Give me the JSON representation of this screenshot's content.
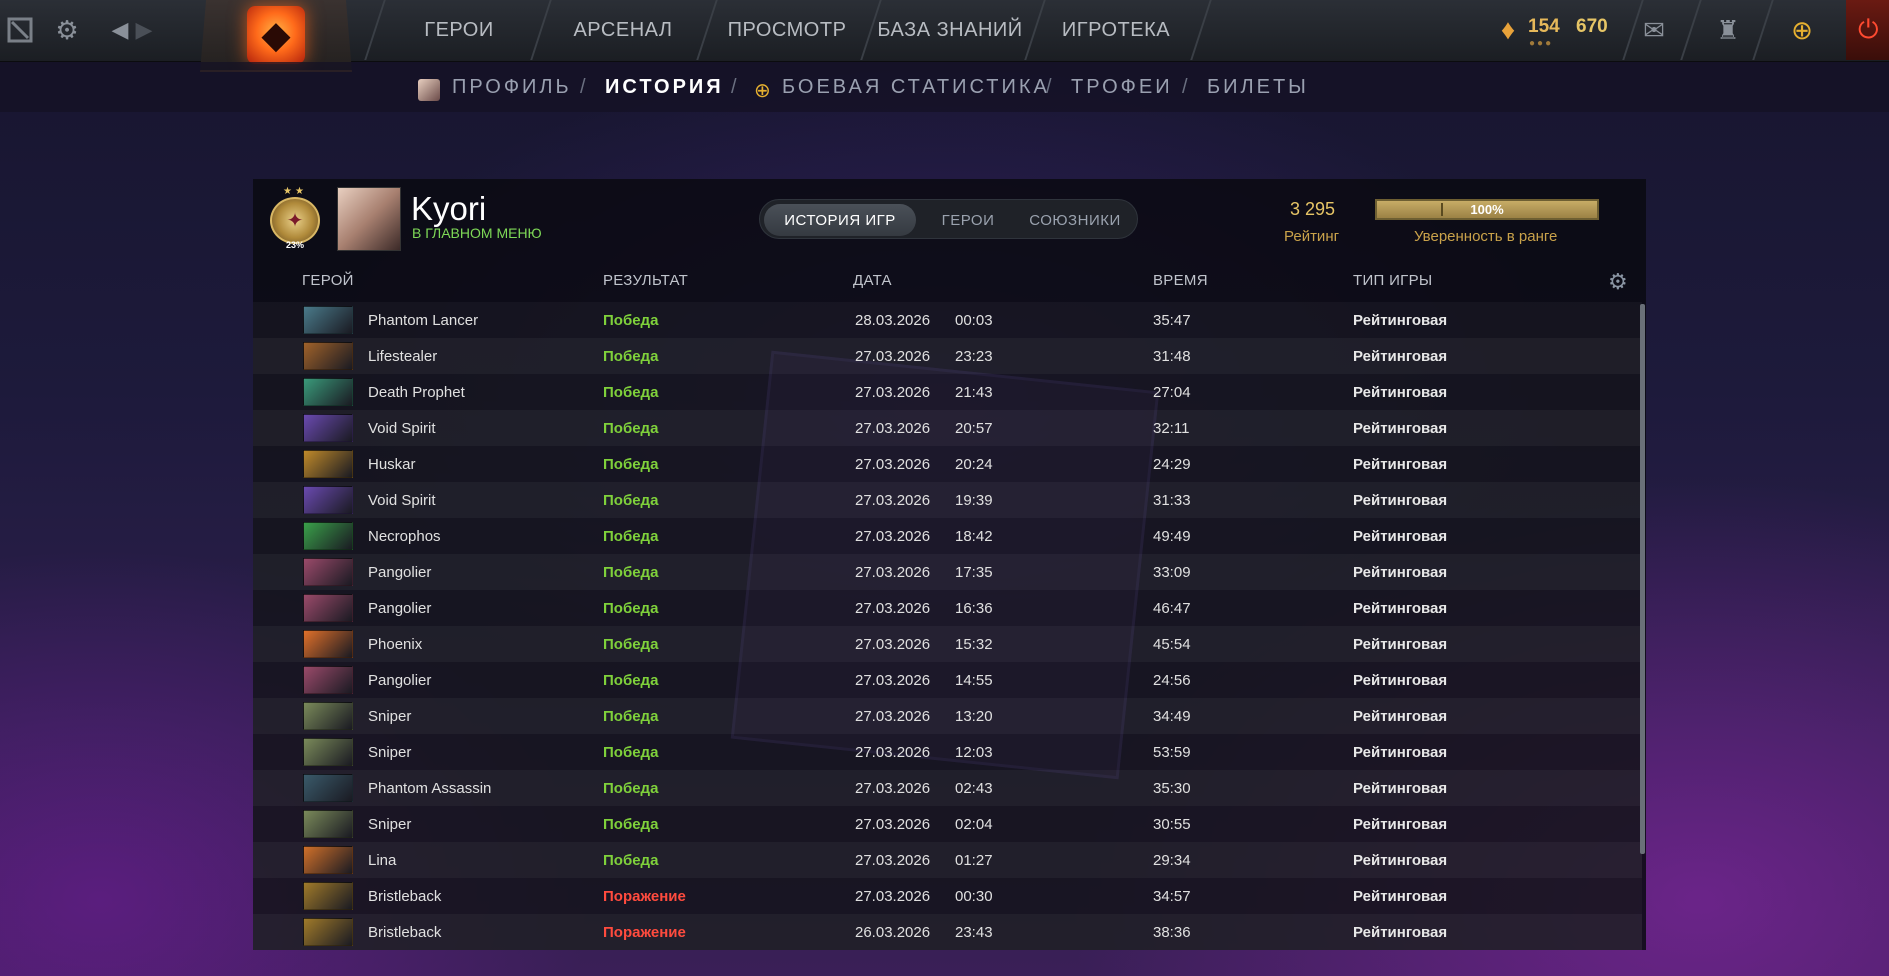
{
  "topbar": {
    "nav": [
      "ГЕРОИ",
      "АРСЕНАЛ",
      "ПРОСМОТР",
      "БАЗА ЗНАНИЙ",
      "ИГРОТЕКА"
    ],
    "shards": "154",
    "gold": "670",
    "shard_color": "#e8a23a"
  },
  "subnav": {
    "items": [
      "ПРОФИЛЬ",
      "ИСТОРИЯ",
      "БОЕВАЯ СТАТИСТИКА",
      "ТРОФЕИ",
      "БИЛЕТЫ"
    ],
    "active_index": 1,
    "separator": "/"
  },
  "player": {
    "name": "Kyori",
    "status": "В ГЛАВНОМ МЕНЮ",
    "rank_percent": "23%",
    "rating_value": "3 295",
    "rating_label": "Рейтинг",
    "confidence_text": "100%",
    "confidence_value": 1.0,
    "confidence_label": "Уверенность в ранге"
  },
  "tabs": [
    "ИСТОРИЯ ИГР",
    "ГЕРОИ",
    "СОЮЗНИКИ"
  ],
  "table": {
    "headers": [
      "ГЕРОЙ",
      "РЕЗУЛЬТАТ",
      "ДАТА",
      "ВРЕМЯ",
      "ТИП ИГРЫ"
    ],
    "rows": [
      {
        "hero": "Phantom Lancer",
        "result": "Победа",
        "win": true,
        "date": "28.03.2026",
        "time": "00:03",
        "duration": "35:47",
        "mode": "Рейтинговая",
        "color": "#4a7a8a"
      },
      {
        "hero": "Lifestealer",
        "result": "Победа",
        "win": true,
        "date": "27.03.2026",
        "time": "23:23",
        "duration": "31:48",
        "mode": "Рейтинговая",
        "color": "#a0622a"
      },
      {
        "hero": "Death Prophet",
        "result": "Победа",
        "win": true,
        "date": "27.03.2026",
        "time": "21:43",
        "duration": "27:04",
        "mode": "Рейтинговая",
        "color": "#3a9a7a"
      },
      {
        "hero": "Void Spirit",
        "result": "Победа",
        "win": true,
        "date": "27.03.2026",
        "time": "20:57",
        "duration": "32:11",
        "mode": "Рейтинговая",
        "color": "#6a4ab0"
      },
      {
        "hero": "Huskar",
        "result": "Победа",
        "win": true,
        "date": "27.03.2026",
        "time": "20:24",
        "duration": "24:29",
        "mode": "Рейтинговая",
        "color": "#c08a2a"
      },
      {
        "hero": "Void Spirit",
        "result": "Победа",
        "win": true,
        "date": "27.03.2026",
        "time": "19:39",
        "duration": "31:33",
        "mode": "Рейтинговая",
        "color": "#6a4ab0"
      },
      {
        "hero": "Necrophos",
        "result": "Победа",
        "win": true,
        "date": "27.03.2026",
        "time": "18:42",
        "duration": "49:49",
        "mode": "Рейтинговая",
        "color": "#3aa04a"
      },
      {
        "hero": "Pangolier",
        "result": "Победа",
        "win": true,
        "date": "27.03.2026",
        "time": "17:35",
        "duration": "33:09",
        "mode": "Рейтинговая",
        "color": "#9a4a6a"
      },
      {
        "hero": "Pangolier",
        "result": "Победа",
        "win": true,
        "date": "27.03.2026",
        "time": "16:36",
        "duration": "46:47",
        "mode": "Рейтинговая",
        "color": "#9a4a6a"
      },
      {
        "hero": "Phoenix",
        "result": "Победа",
        "win": true,
        "date": "27.03.2026",
        "time": "15:32",
        "duration": "45:54",
        "mode": "Рейтинговая",
        "color": "#e0702a"
      },
      {
        "hero": "Pangolier",
        "result": "Победа",
        "win": true,
        "date": "27.03.2026",
        "time": "14:55",
        "duration": "24:56",
        "mode": "Рейтинговая",
        "color": "#9a4a6a"
      },
      {
        "hero": "Sniper",
        "result": "Победа",
        "win": true,
        "date": "27.03.2026",
        "time": "13:20",
        "duration": "34:49",
        "mode": "Рейтинговая",
        "color": "#7a8a5a"
      },
      {
        "hero": "Sniper",
        "result": "Победа",
        "win": true,
        "date": "27.03.2026",
        "time": "12:03",
        "duration": "53:59",
        "mode": "Рейтинговая",
        "color": "#7a8a5a"
      },
      {
        "hero": "Phantom Assassin",
        "result": "Победа",
        "win": true,
        "date": "27.03.2026",
        "time": "02:43",
        "duration": "35:30",
        "mode": "Рейтинговая",
        "color": "#3a5a6a"
      },
      {
        "hero": "Sniper",
        "result": "Победа",
        "win": true,
        "date": "27.03.2026",
        "time": "02:04",
        "duration": "30:55",
        "mode": "Рейтинговая",
        "color": "#7a8a5a"
      },
      {
        "hero": "Lina",
        "result": "Победа",
        "win": true,
        "date": "27.03.2026",
        "time": "01:27",
        "duration": "29:34",
        "mode": "Рейтинговая",
        "color": "#d0702a"
      },
      {
        "hero": "Bristleback",
        "result": "Поражение",
        "win": false,
        "date": "27.03.2026",
        "time": "00:30",
        "duration": "34:57",
        "mode": "Рейтинговая",
        "color": "#a07a2a"
      },
      {
        "hero": "Bristleback",
        "result": "Поражение",
        "win": false,
        "date": "26.03.2026",
        "time": "23:43",
        "duration": "38:36",
        "mode": "Рейтинговая",
        "color": "#a07a2a"
      }
    ]
  }
}
